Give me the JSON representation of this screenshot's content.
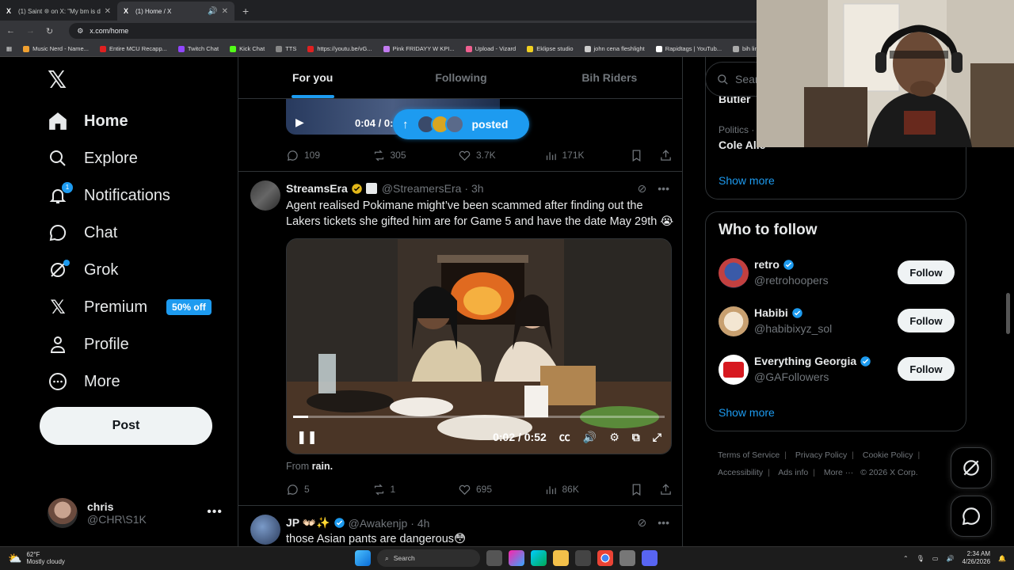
{
  "browser": {
    "tabs": [
      {
        "label": "(1) Saint ❊ on X: \"My bm is doi",
        "active": false
      },
      {
        "label": "(1) Home / X",
        "active": true
      }
    ],
    "url": "x.com/home",
    "bookmarks": [
      "Music Nerd - Name...",
      "Entire MCU Recapp...",
      "Twitch Chat",
      "Kick Chat",
      "TTS",
      "https://youtu.be/vG...",
      "Pink FRIDAYY W KPI...",
      "Upload - Vizard",
      "Eklipse studio",
      "john cena fleshlight",
      "Rapidtags | YouTub...",
      "bih links"
    ]
  },
  "nav": {
    "home": "Home",
    "explore": "Explore",
    "notifications": "Notifications",
    "notifications_badge": "1",
    "chat": "Chat",
    "grok": "Grok",
    "premium": "Premium",
    "premium_promo": "50% off",
    "profile": "Profile",
    "more": "More",
    "post": "Post"
  },
  "account": {
    "name": "chris",
    "handle": "@CHR\\S1K"
  },
  "feed": {
    "tabs": [
      "For you",
      "Following",
      "Bih Riders"
    ],
    "prev_tweet": {
      "time": "0:04 / 0:",
      "posted_pill": "posted",
      "replies": "109",
      "retweets": "305",
      "likes": "3.7K",
      "views": "171K"
    },
    "tweet1": {
      "name": "StreamsEra",
      "handle": "@StreamersEra",
      "time": "· 3h",
      "text": "Agent realised Pokimane might’ve been scammed after finding out the Lakers tickets she gifted him are for Game 5 and have the date May 29th 😭",
      "video_time": "0:02 / 0:52",
      "video_progress": 0.04,
      "from_label": "From",
      "from_source": "rain.",
      "replies": "5",
      "retweets": "1",
      "likes": "695",
      "views": "86K"
    },
    "tweet2": {
      "name": "JP 👐🏻✨",
      "handle": "@Awakenjp",
      "time": "· 4h",
      "text": "those Asian pants are dangerous😳"
    }
  },
  "right": {
    "search_placeholder": "Searc",
    "trend_top_partial": "Butler",
    "trend_cat": "Politics ·",
    "trend_title": "Cole Alle",
    "show_more": "Show more",
    "who_to_follow": "Who to follow",
    "follow_users": [
      {
        "name": "retro",
        "handle": "@retrohoopers",
        "btn": "Follow"
      },
      {
        "name": "Habibi",
        "handle": "@habibixyz_sol",
        "btn": "Follow"
      },
      {
        "name": "Everything Georgia",
        "handle": "@GAFollowers",
        "btn": "Follow"
      }
    ],
    "show_more2": "Show more",
    "footer": [
      "Terms of Service",
      "Privacy Policy",
      "Cookie Policy",
      "Accessibility",
      "Ads info",
      "More ···",
      "© 2026 X Corp."
    ]
  },
  "taskbar": {
    "temp": "62°F",
    "weather": "Mostly cloudy",
    "search": "Search",
    "time": "2:34 AM",
    "date": "4/26/2026"
  },
  "colors": {
    "accent": "#1d9bf0",
    "bg": "#000000",
    "border": "#2f3336",
    "muted": "#71767b"
  }
}
